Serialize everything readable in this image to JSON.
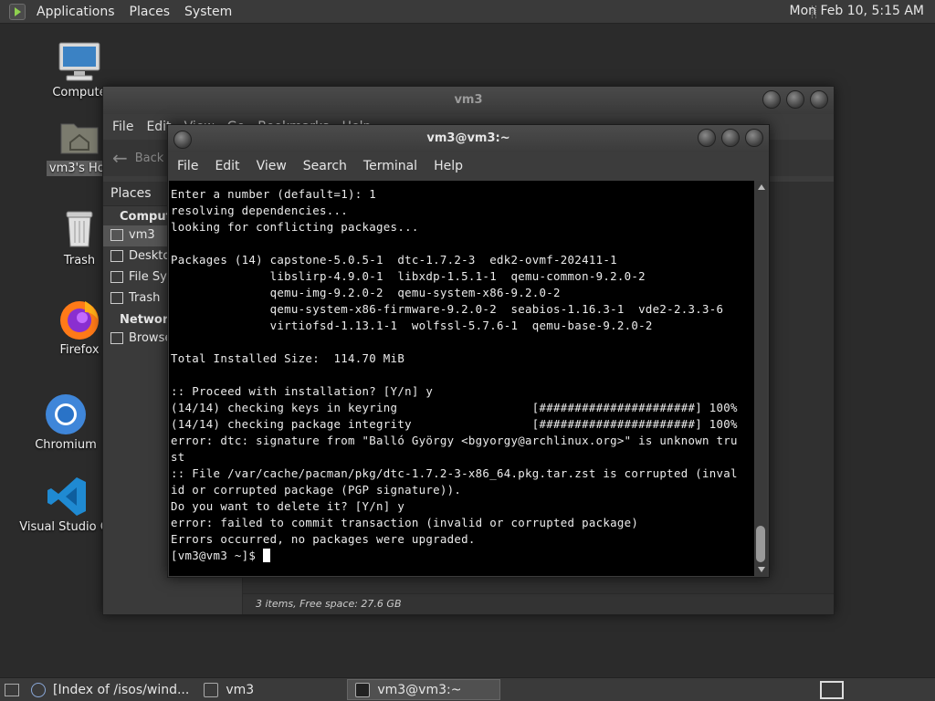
{
  "top_panel": {
    "menus": [
      "Applications",
      "Places",
      "System"
    ],
    "clock": "Mon Feb 10,  5:15 AM"
  },
  "desktop_icons": [
    {
      "label": "Compute",
      "icon": "computer-icon"
    },
    {
      "label": "vm3's Hor",
      "icon": "home-folder-icon"
    },
    {
      "label": "Trash",
      "icon": "trash-icon"
    },
    {
      "label": "Firefox",
      "icon": "firefox-icon"
    },
    {
      "label": "Chromium",
      "icon": "chromium-icon"
    },
    {
      "label": "Visual Studio Co",
      "icon": "vscode-icon"
    }
  ],
  "file_manager": {
    "title": "vm3",
    "menu": [
      "File",
      "Edit",
      "View",
      "Go",
      "Bookmarks",
      "Help"
    ],
    "back_label": "Back",
    "sidebar": {
      "header": "Places",
      "groups": [
        {
          "name": "Computer",
          "items": [
            "vm3",
            "Desktop",
            "File System",
            "Trash"
          ]
        },
        {
          "name": "Network",
          "items": [
            "Browse Network"
          ]
        }
      ]
    },
    "status": "3 items, Free space: 27.6 GB"
  },
  "terminal": {
    "title": "vm3@vm3:~",
    "menu": [
      "File",
      "Edit",
      "View",
      "Search",
      "Terminal",
      "Help"
    ],
    "lines": [
      "Enter a number (default=1): 1",
      "resolving dependencies...",
      "looking for conflicting packages...",
      "",
      "Packages (14) capstone-5.0.5-1  dtc-1.7.2-3  edk2-ovmf-202411-1",
      "              libslirp-4.9.0-1  libxdp-1.5.1-1  qemu-common-9.2.0-2",
      "              qemu-img-9.2.0-2  qemu-system-x86-9.2.0-2",
      "              qemu-system-x86-firmware-9.2.0-2  seabios-1.16.3-1  vde2-2.3.3-6",
      "              virtiofsd-1.13.1-1  wolfssl-5.7.6-1  qemu-base-9.2.0-2",
      "",
      "Total Installed Size:  114.70 MiB",
      "",
      ":: Proceed with installation? [Y/n] y",
      "(14/14) checking keys in keyring                   [######################] 100%",
      "(14/14) checking package integrity                 [######################] 100%",
      "error: dtc: signature from \"Balló György <bgyorgy@archlinux.org>\" is unknown tru",
      "st",
      ":: File /var/cache/pacman/pkg/dtc-1.7.2-3-x86_64.pkg.tar.zst is corrupted (inval",
      "id or corrupted package (PGP signature)).",
      "Do you want to delete it? [Y/n] y",
      "error: failed to commit transaction (invalid or corrupted package)",
      "Errors occurred, no packages were upgraded."
    ],
    "prompt": "[vm3@vm3 ~]$ "
  },
  "taskbar": {
    "tasks": [
      {
        "label": "[Index of /isos/wind...",
        "icon": "browser-icon",
        "active": false
      },
      {
        "label": "vm3",
        "icon": "folder-icon",
        "active": false
      },
      {
        "label": "vm3@vm3:~",
        "icon": "terminal-icon",
        "active": true
      }
    ]
  }
}
